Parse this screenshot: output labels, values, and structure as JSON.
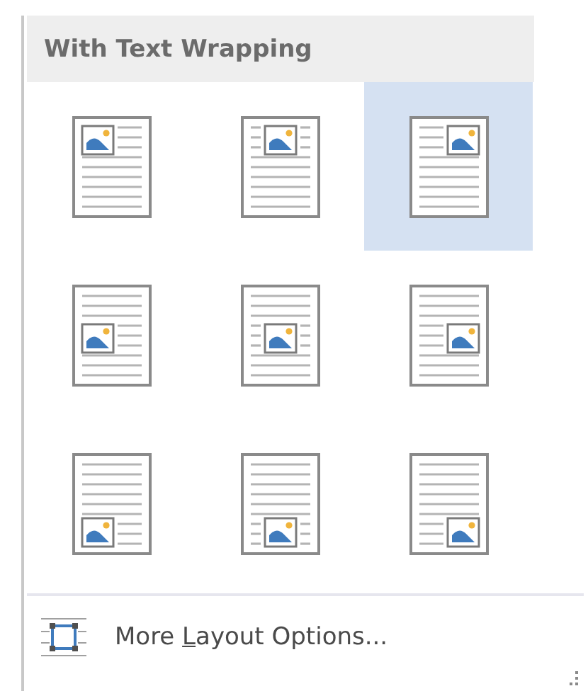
{
  "section_header": "With Text Wrapping",
  "layouts": [
    {
      "kind": "topleft",
      "selected": false
    },
    {
      "kind": "topcenter",
      "selected": false
    },
    {
      "kind": "topright",
      "selected": true
    },
    {
      "kind": "middleleft",
      "selected": false
    },
    {
      "kind": "middlecenter",
      "selected": false
    },
    {
      "kind": "middleright",
      "selected": false
    },
    {
      "kind": "bottomleft",
      "selected": false
    },
    {
      "kind": "bottomcenter",
      "selected": false
    },
    {
      "kind": "bottomright",
      "selected": false
    }
  ],
  "menu_item": {
    "label_before_key": "More ",
    "access_key": "L",
    "label_after_key": "ayout Options..."
  }
}
